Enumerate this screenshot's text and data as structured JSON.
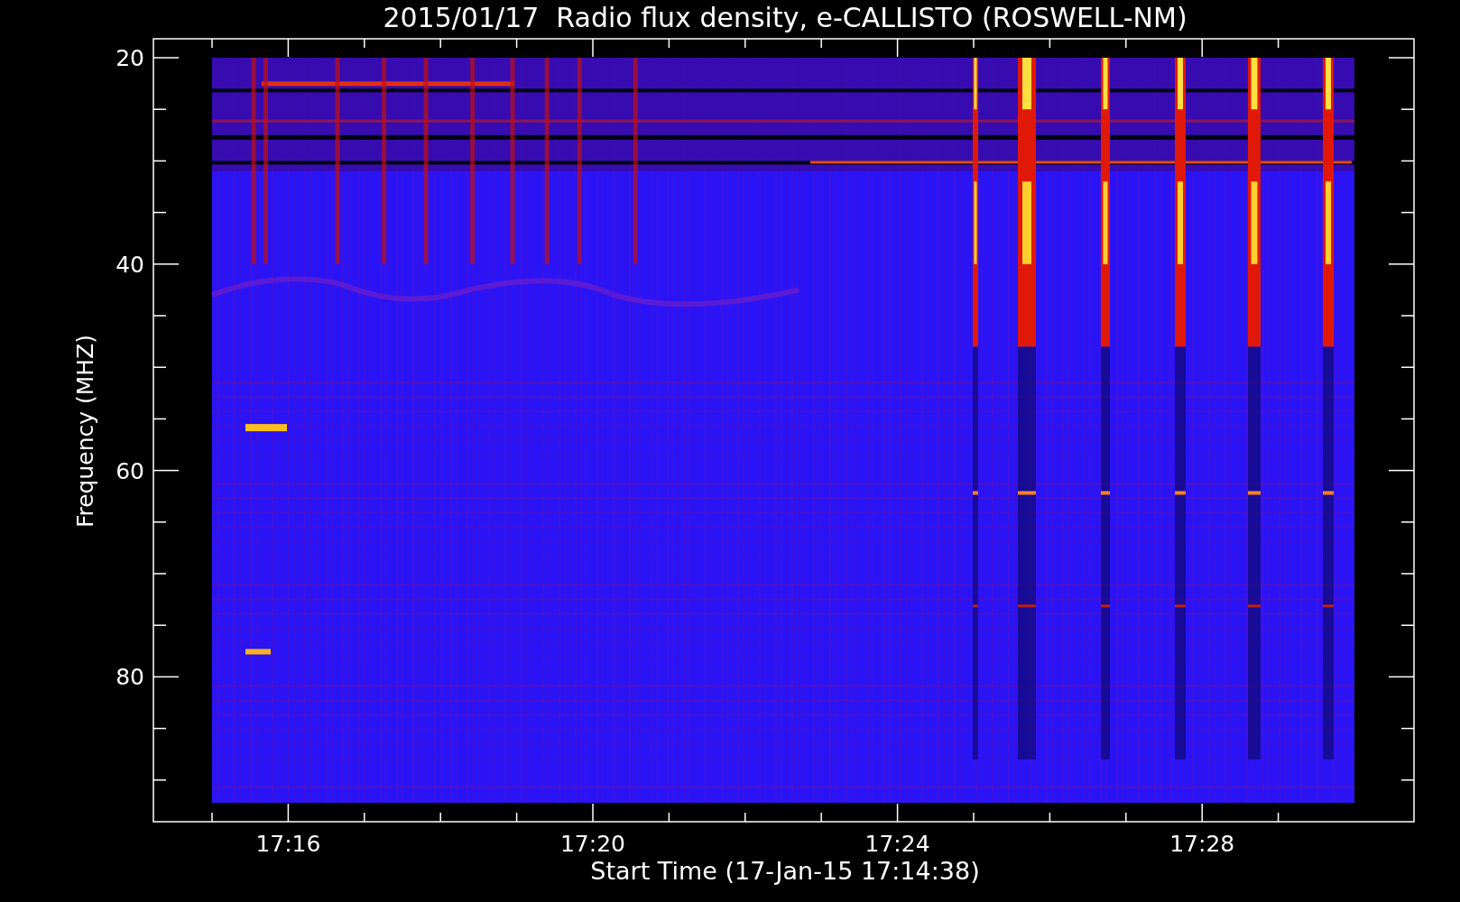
{
  "title": "2015/01/17  Radio flux density, e-CALLISTO (ROSWELL-NM)",
  "xlabel": "Start Time (17-Jan-15 17:14:38)",
  "ylabel": "Frequency (MHZ)",
  "yticks": [
    "20",
    "40",
    "60",
    "80"
  ],
  "xticks": [
    "17:16",
    "17:20",
    "17:24",
    "17:28"
  ]
}
